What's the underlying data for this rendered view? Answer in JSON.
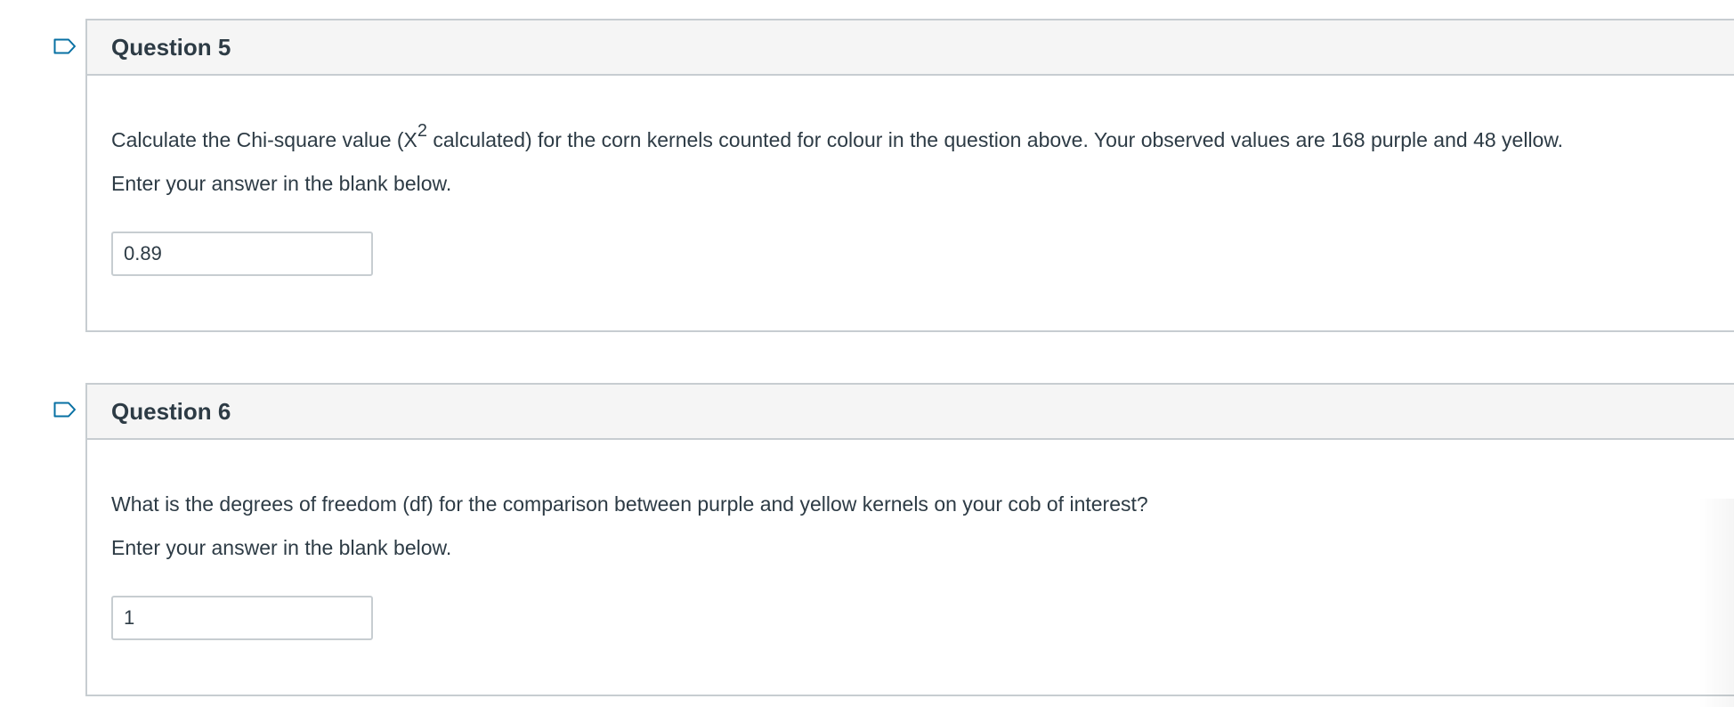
{
  "questions": [
    {
      "title": "Question 5",
      "prompt_before_sup": "Calculate the Chi-square value (X",
      "prompt_sup": "2",
      "prompt_after_sup": " calculated) for the corn kernels counted for colour in the question above. Your observed values are 168 purple and 48 yellow.",
      "instruction": "Enter your answer in the blank below.",
      "answer_value": "0.89",
      "flag_icon": "bookmark-flag-icon"
    },
    {
      "title": "Question 6",
      "prompt": "What is the degrees of freedom (df) for the comparison between purple and yellow kernels on your cob of interest?",
      "instruction": "Enter your answer in the blank below.",
      "answer_value": "1",
      "flag_icon": "bookmark-flag-icon"
    }
  ],
  "colors": {
    "text": "#2d3b45",
    "border": "#c7cdd1",
    "header_bg": "#f5f5f5",
    "flag_stroke": "#0770a3"
  }
}
